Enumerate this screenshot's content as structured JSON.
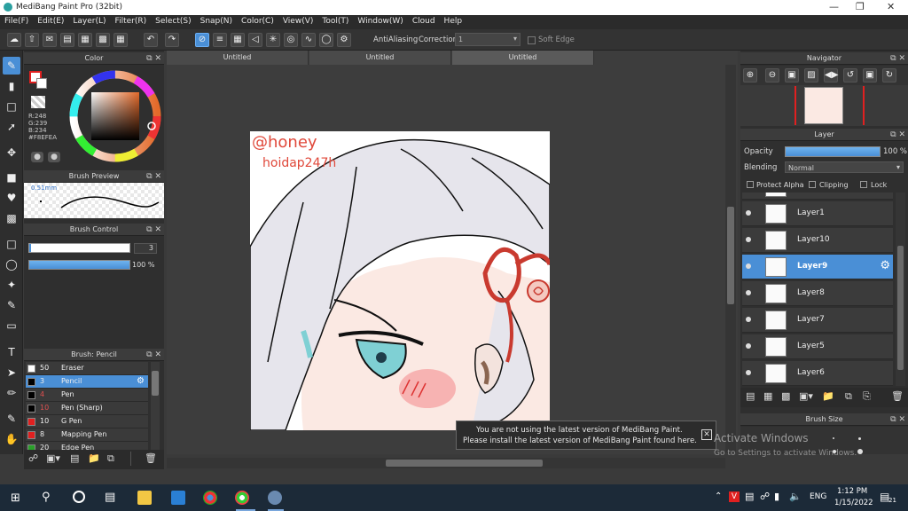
{
  "window": {
    "title": "MediBang Paint Pro (32bit)"
  },
  "menu": [
    "File(F)",
    "Edit(E)",
    "Layer(L)",
    "Filter(R)",
    "Select(S)",
    "Snap(N)",
    "Color(C)",
    "View(V)",
    "Tool(T)",
    "Window(W)",
    "Cloud",
    "Help"
  ],
  "toolbar": {
    "antialiasing_label": "AntiAliasing",
    "correction_label": "Correction",
    "correction_value": "1",
    "soft_edge_label": "Soft Edge"
  },
  "color_panel": {
    "title": "Color",
    "r": "R:248",
    "g": "G:239",
    "b": "B:234",
    "hex": "#F8EFEA",
    "primary_color": "#e02020",
    "hue_color": "#e36a2a"
  },
  "brush_preview": {
    "title": "Brush Preview",
    "size": "0.51mm"
  },
  "brush_control": {
    "title": "Brush Control",
    "size_value": "3",
    "opacity_value": "100 %"
  },
  "brush_list": {
    "title": "Brush: Pencil",
    "items": [
      {
        "size": "50",
        "name": "Eraser",
        "color": "#ffffff"
      },
      {
        "size": "3",
        "name": "Pencil",
        "color": "#000000"
      },
      {
        "size": "4",
        "name": "Pen",
        "color": "#000000"
      },
      {
        "size": "10",
        "name": "Pen (Sharp)",
        "color": "#000000"
      },
      {
        "size": "10",
        "name": "G Pen",
        "color": "#e02020"
      },
      {
        "size": "8",
        "name": "Mapping Pen",
        "color": "#e02020"
      },
      {
        "size": "20",
        "name": "Edge Pen",
        "color": "#2aa02a"
      }
    ]
  },
  "tabs": [
    "Untitled",
    "Untitled",
    "Untitled"
  ],
  "canvas": {
    "signature_line1": "@honey",
    "signature_line2": "hoidap247h"
  },
  "notice": {
    "line1": "You are not using the latest version of MediBang Paint.",
    "line2": "Please install the latest version of MediBang Paint found here."
  },
  "navigator": {
    "title": "Navigator"
  },
  "layer_panel": {
    "title": "Layer",
    "opacity_label": "Opacity",
    "opacity_value": "100 %",
    "blending_label": "Blending",
    "blending_value": "Normal",
    "protect_alpha": "Protect Alpha",
    "clipping": "Clipping",
    "lock": "Lock",
    "layers": [
      "Layer1",
      "Layer10",
      "Layer9",
      "Layer8",
      "Layer7",
      "Layer5",
      "Layer6"
    ],
    "selected": "Layer9"
  },
  "brush_size_panel": {
    "title": "Brush Size"
  },
  "watermark": {
    "line1": "Activate Windows",
    "line2": "Go to Settings to activate Windows."
  },
  "taskbar": {
    "language": "ENG",
    "time": "1:12 PM",
    "date": "1/15/2022",
    "notification_count": "21"
  }
}
